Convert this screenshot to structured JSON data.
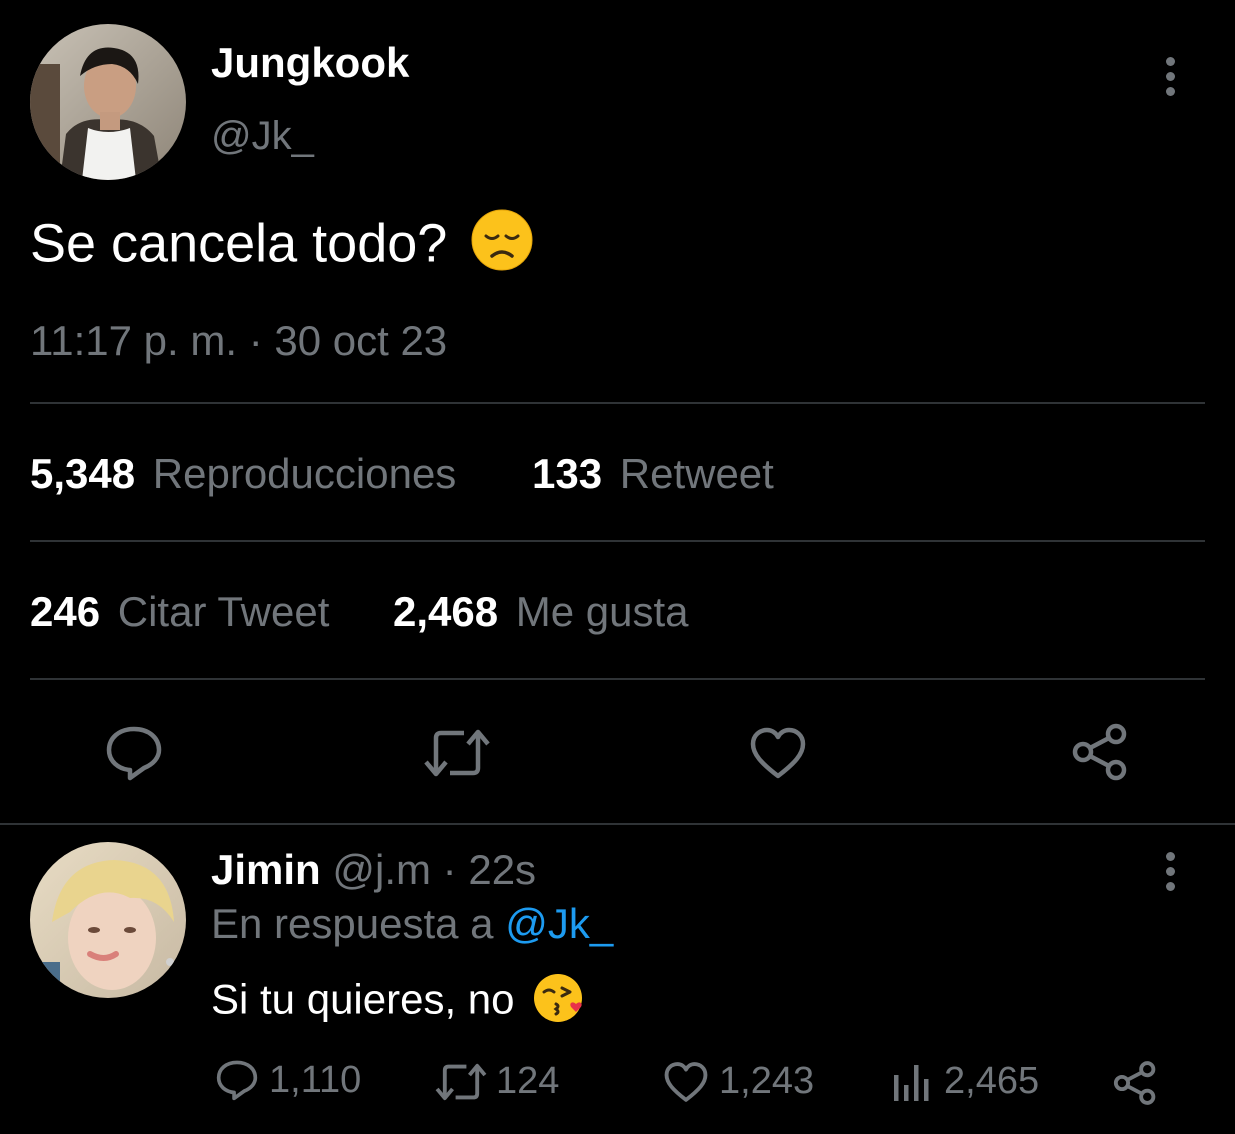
{
  "tweet": {
    "author_name": "Jungkook",
    "author_handle": "@Jk_",
    "text": "Se cancela todo?",
    "emoji": "disappointed-face",
    "time": "11:17 p. m.",
    "separator": "·",
    "date": "30 oct 23",
    "stats": {
      "views_count": "5,348",
      "views_label": "Reproducciones",
      "retweets_count": "133",
      "retweets_label": "Retweet",
      "quotes_count": "246",
      "quotes_label": "Citar Tweet",
      "likes_count": "2,468",
      "likes_label": "Me gusta"
    },
    "actions": [
      "reply-icon",
      "retweet-icon",
      "like-icon",
      "share-icon"
    ]
  },
  "reply": {
    "author_name": "Jimin",
    "author_handle": "@j.m",
    "separator": "·",
    "time_ago": "22s",
    "replying_to_label": "En respuesta a",
    "replying_to_handle": "@Jk_",
    "text": "Si tu quieres, no",
    "emoji": "face-blowing-a-kiss",
    "counts": {
      "replies": "1,110",
      "retweets": "124",
      "likes": "1,243",
      "views": "2,465"
    }
  },
  "colors": {
    "background": "#000000",
    "text": "#ffffff",
    "muted": "#71767b",
    "link": "#1d9bf0",
    "divider": "#2f3336"
  }
}
